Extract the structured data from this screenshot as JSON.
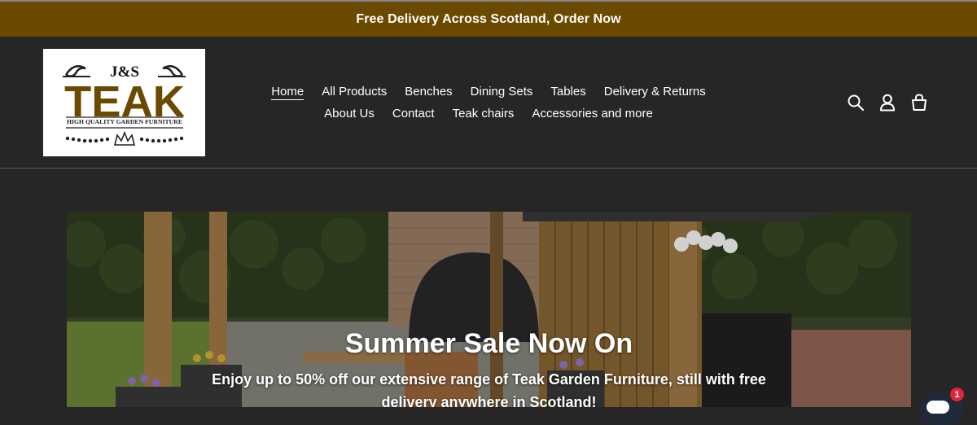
{
  "announcement": {
    "text": "Free Delivery Across Scotland, Order Now"
  },
  "logo": {
    "line1": "J&S",
    "line2": "TEAK",
    "tagline": "HIGH QUALITY GARDEN FURNITURE",
    "brand_color": "#6b4a00"
  },
  "nav": {
    "row1": [
      {
        "label": "Home",
        "active": true
      },
      {
        "label": "All Products"
      },
      {
        "label": "Benches"
      },
      {
        "label": "Dining Sets"
      },
      {
        "label": "Tables"
      },
      {
        "label": "Delivery & Returns"
      }
    ],
    "row2": [
      {
        "label": "About Us"
      },
      {
        "label": "Contact"
      },
      {
        "label": "Teak chairs"
      },
      {
        "label": "Accessories and more"
      }
    ]
  },
  "header_icons": [
    "search-icon",
    "account-icon",
    "cart-icon"
  ],
  "hero": {
    "title": "Summer Sale Now On",
    "subtitle": "Enjoy up to 50% off our extensive range of Teak Garden Furniture, still with free delivery anywhere in Scotland!"
  },
  "chat": {
    "badge_count": "1"
  },
  "colors": {
    "announcement_bg": "#6b4a00",
    "page_bg": "#262626",
    "text": "#ffffff",
    "badge": "#e3233b"
  }
}
